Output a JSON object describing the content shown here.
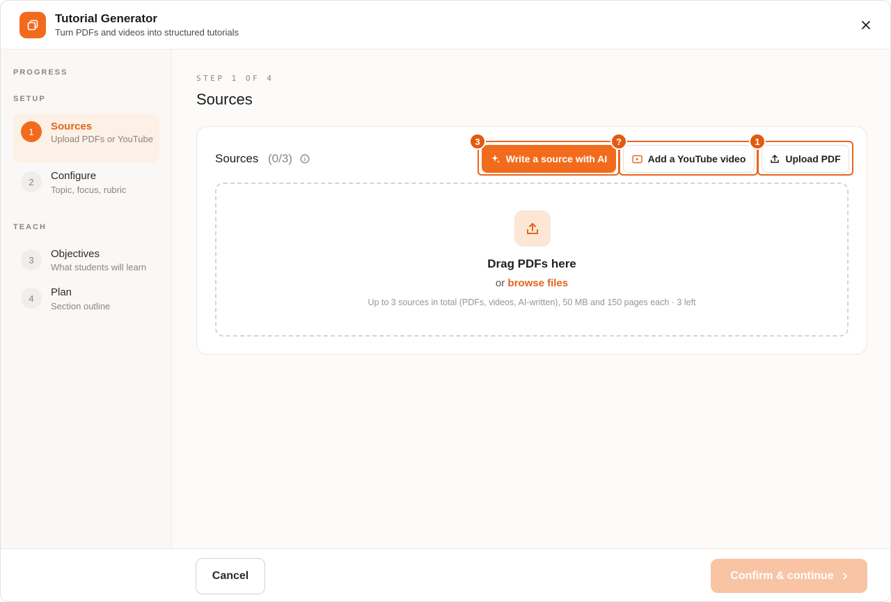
{
  "header": {
    "title": "Tutorial Generator",
    "subtitle": "Turn PDFs and videos into structured tutorials",
    "logo_icon": "stacked-squares-icon",
    "close_icon": "close-icon"
  },
  "sidebar": {
    "progress_label": "PROGRESS",
    "groups": [
      {
        "label": "SETUP",
        "steps": [
          {
            "number": "1",
            "title": "Sources",
            "description": "Upload PDFs or YouTube",
            "active": true
          },
          {
            "number": "2",
            "title": "Configure",
            "description": "Topic, focus, rubric",
            "active": false
          }
        ]
      },
      {
        "label": "TEACH",
        "steps": [
          {
            "number": "3",
            "title": "Objectives",
            "description": "What students will learn",
            "active": false
          },
          {
            "number": "4",
            "title": "Plan",
            "description": "Section outline",
            "active": false
          }
        ]
      }
    ]
  },
  "main": {
    "step_kicker": "STEP 1 OF 4",
    "page_title": "Sources",
    "card": {
      "title": "Sources",
      "count": "(0/3)",
      "buttons": [
        {
          "label": "Write a source with AI",
          "icon": "sparkle-icon",
          "badge": "3"
        },
        {
          "label": "Add a YouTube video",
          "icon": "youtube-icon",
          "badge": "?"
        },
        {
          "label": "Upload PDF",
          "icon": "upload-icon",
          "badge": "1"
        }
      ],
      "dropzone": {
        "title": "Drag PDFs here",
        "or_text": "or",
        "browse_link": "browse files",
        "hint": "Up to 3 sources in total (PDFs, videos, AI-written), 50 MB and 150 pages each · 3 left"
      }
    }
  },
  "footer": {
    "cancel_label": "Cancel",
    "confirm_label": "Confirm & continue"
  },
  "colors": {
    "accent": "#f26b1d",
    "accent_light": "#fde6d3",
    "confirm_disabled": "#f8c4a3"
  }
}
